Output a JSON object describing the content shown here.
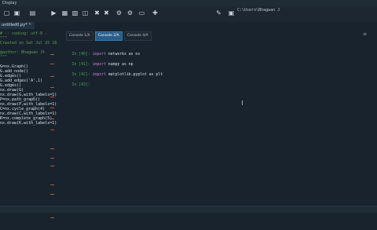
{
  "menu": {
    "label": "Display"
  },
  "path": "C:\\Users\\Bhagwan J",
  "editor": {
    "tab_label": "untitled0.py*",
    "tab_close": "×",
    "lines": [
      {
        "type": "c",
        "text": "# -- coding: utf-8 -"
      },
      {
        "type": "c",
        "text": "\"\"\""
      },
      {
        "type": "c",
        "text": "Created on Sat Jul 25 18:3"
      },
      {
        "type": "c",
        "text": ""
      },
      {
        "type": "c",
        "text": "@author: Bhagwan Jt"
      },
      {
        "type": "c",
        "text": "\"\"\""
      },
      {
        "type": "d",
        "text": ""
      },
      {
        "type": "d",
        "text": "G=nx.Graph()"
      },
      {
        "type": "d",
        "text": "G.add_node()"
      },
      {
        "type": "d",
        "text": "G.edges()"
      },
      {
        "type": "d",
        "text": "G.add_edges('A',1)"
      },
      {
        "type": "d",
        "text": "G.edges()"
      },
      {
        "type": "d",
        "text": "nx.draw(G)"
      },
      {
        "type": "d",
        "text": "nx.draw(G,with_labels=1)"
      },
      {
        "type": "d",
        "text": "P=nx.path_graph()"
      },
      {
        "type": "d",
        "text": "nx.draw(P,with_labels=1)"
      },
      {
        "type": "d",
        "text": "C=nx.cycle_graph(4)"
      },
      {
        "type": "d",
        "text": "nx.draw(C,with_labels=1)"
      },
      {
        "type": "d",
        "text": "K=nx.complete_graph(5)"
      },
      {
        "type": "d",
        "text": "nx.draw(K,with_labels=1)"
      }
    ]
  },
  "console": {
    "tabs": [
      {
        "label": "Console 1/A",
        "active": false
      },
      {
        "label": "Console 2/A",
        "active": true
      },
      {
        "label": "Console 4/A",
        "active": false
      }
    ],
    "lines": [
      {
        "prompt": "In [40]:",
        "kw": "import",
        "code": " networkx as nx"
      },
      {
        "prompt": "In [41]:",
        "kw": "import",
        "code": " numpy as np"
      },
      {
        "prompt": "In [42]:",
        "kw": "import",
        "code": " matplotlib.pyplot as plt"
      },
      {
        "prompt": "In [43]:",
        "kw": "",
        "code": ""
      }
    ]
  }
}
